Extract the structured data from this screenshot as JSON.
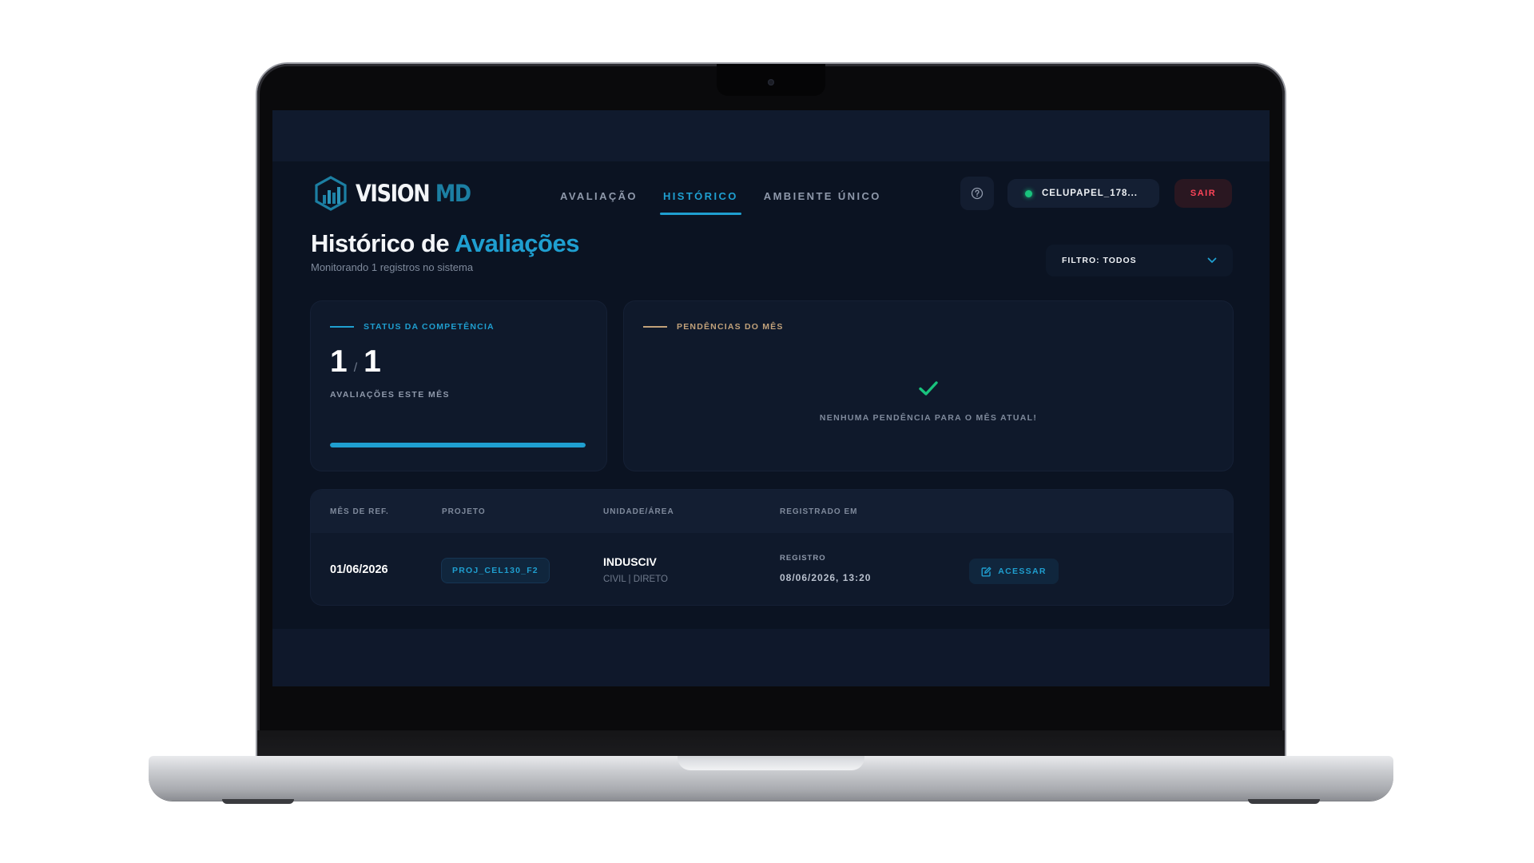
{
  "app": {
    "logo_primary": "VISION",
    "logo_secondary": "MD"
  },
  "nav": {
    "items": [
      {
        "label": "AVALIAÇÃO",
        "active": false
      },
      {
        "label": "HISTÓRICO",
        "active": true
      },
      {
        "label": "AMBIENTE ÚNICO",
        "active": false
      }
    ]
  },
  "header": {
    "help_icon": "help-circle-icon",
    "user_status": "online",
    "user_label": "CELUPAPEL_178...",
    "logout_label": "SAIR"
  },
  "page": {
    "title_part1": "Histórico de",
    "title_part2": "Avaliações",
    "subtitle": "Monitorando 1 registros no sistema",
    "filter_label": "FILTRO: TODOS"
  },
  "status_card": {
    "label": "STATUS DA COMPETÊNCIA",
    "done": "1",
    "separator": "/",
    "total": "1",
    "caption": "AVALIAÇÕES ESTE MÊS",
    "progress": 1.0
  },
  "pending_card": {
    "label": "PENDÊNCIAS DO MÊS",
    "icon": "check-icon",
    "message": "NENHUMA PENDÊNCIA PARA O MÊS ATUAL!"
  },
  "table": {
    "headers": [
      "MÊS DE REF.",
      "PROJETO",
      "UNIDADE/ÁREA",
      "REGISTRADO EM"
    ],
    "rows": [
      {
        "month": "01/06/2026",
        "project": "PROJ_CEL130_F2",
        "unit": "INDUSCIV",
        "unit_sub": "CIVIL | DIRETO",
        "registered_label": "REGISTRO",
        "registered_at": "08/06/2026, 13:20",
        "action_label": "ACESSAR",
        "action_icon": "edit-icon"
      }
    ]
  },
  "colors": {
    "accent": "#1f9fd0",
    "background": "#0b1322",
    "danger": "#ff4458",
    "success": "#19c37d",
    "pending_accent": "#c1a17a"
  }
}
